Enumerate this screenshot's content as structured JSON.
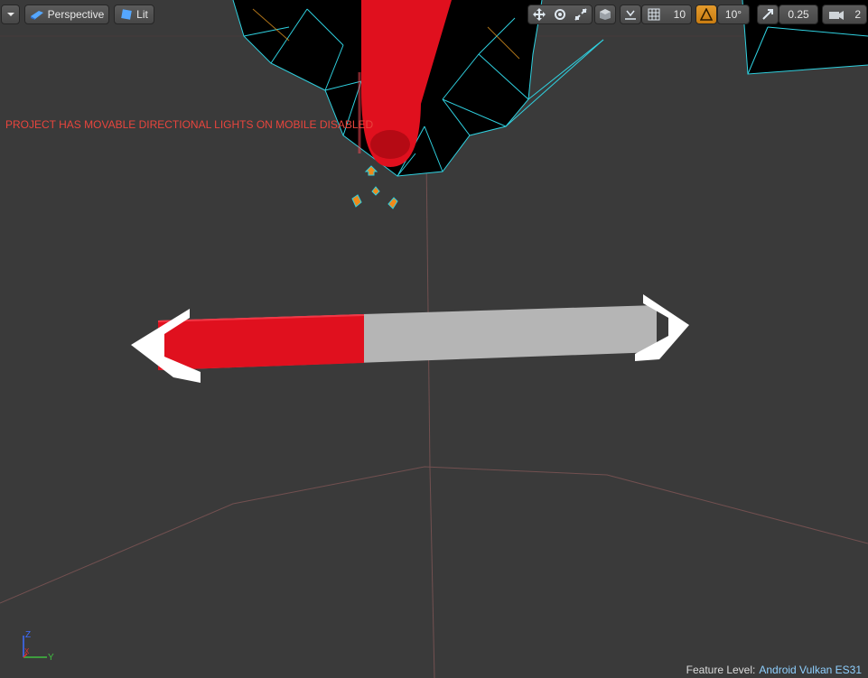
{
  "toolbar": {
    "view_mode": "Perspective",
    "lighting_mode": "Lit",
    "grid_snap_value": "10",
    "rotation_snap_value": "10°",
    "scale_snap_value": "0.25",
    "camera_speed_value": "2"
  },
  "icons": {
    "viewport_menu": "chevron-down-icon",
    "perspective": "perspective-cube-icon",
    "lit": "lit-sphere-icon",
    "translate": "move-arrows-icon",
    "rotate": "rotate-icon",
    "scale": "scale-icon",
    "world_local": "cube-icon",
    "surface_snap": "surface-snap-icon",
    "grid": "grid-icon",
    "rotation": "angle-icon",
    "scale_snap": "diagonal-arrow-icon",
    "camera": "camera-icon"
  },
  "warning_text": "PROJECT HAS MOVABLE DIRECTIONAL LIGHTS ON MOBILE DISABLED",
  "status": {
    "feature_label": "Feature Level:",
    "feature_value": "Android Vulkan ES31"
  },
  "axis_labels": {
    "z": "Z",
    "y": "Y",
    "x": "X"
  },
  "colors": {
    "background": "#3a3a3a",
    "warning": "#e8453d",
    "accent_orange": "#d9901f",
    "wire_cyan": "#2fd1e0",
    "gizmo_red": "#e0101e",
    "slider_gray": "#b5b5b5",
    "feature_value": "#8fd0ff"
  },
  "slider": {
    "fill_fraction": 0.43
  }
}
